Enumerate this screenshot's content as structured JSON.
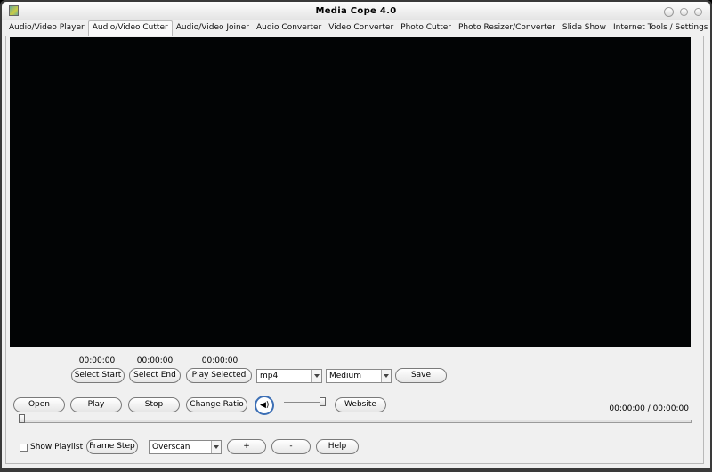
{
  "window": {
    "title": "Media Cope 4.0"
  },
  "tabs": [
    {
      "label": "Audio/Video Player"
    },
    {
      "label": "Audio/Video Cutter"
    },
    {
      "label": "Audio/Video Joiner"
    },
    {
      "label": "Audio Converter"
    },
    {
      "label": "Video Converter"
    },
    {
      "label": "Photo Cutter"
    },
    {
      "label": "Photo Resizer/Converter"
    },
    {
      "label": "Slide Show"
    },
    {
      "label": "Internet Tools / Settings"
    }
  ],
  "active_tab": "Audio/Video Cutter",
  "cutter": {
    "start_time": "00:00:00",
    "end_time": "00:00:00",
    "selected_time": "00:00:00",
    "select_start_label": "Select Start",
    "select_end_label": "Select End",
    "play_selected_label": "Play Selected",
    "format_value": "mp4",
    "quality_value": "Medium",
    "save_label": "Save"
  },
  "player": {
    "open_label": "Open",
    "play_label": "Play",
    "stop_label": "Stop",
    "change_ratio_label": "Change Ratio",
    "website_label": "Website",
    "time_display": "00:00:00 / 00:00:00",
    "volume_fraction": 1.0,
    "seek_fraction": 0.0
  },
  "bottom": {
    "show_playlist_label": "Show Playlist",
    "show_playlist_checked": false,
    "frame_step_label": "Frame Step",
    "overscan_value": "Overscan",
    "plus_label": "+",
    "minus_label": "-",
    "help_label": "Help"
  },
  "icons": {
    "speaker": "speaker-icon",
    "chevron": "chevron-down-icon"
  },
  "colors": {
    "video_bg": "#020405",
    "speaker_ring": "#3c6fb5"
  }
}
